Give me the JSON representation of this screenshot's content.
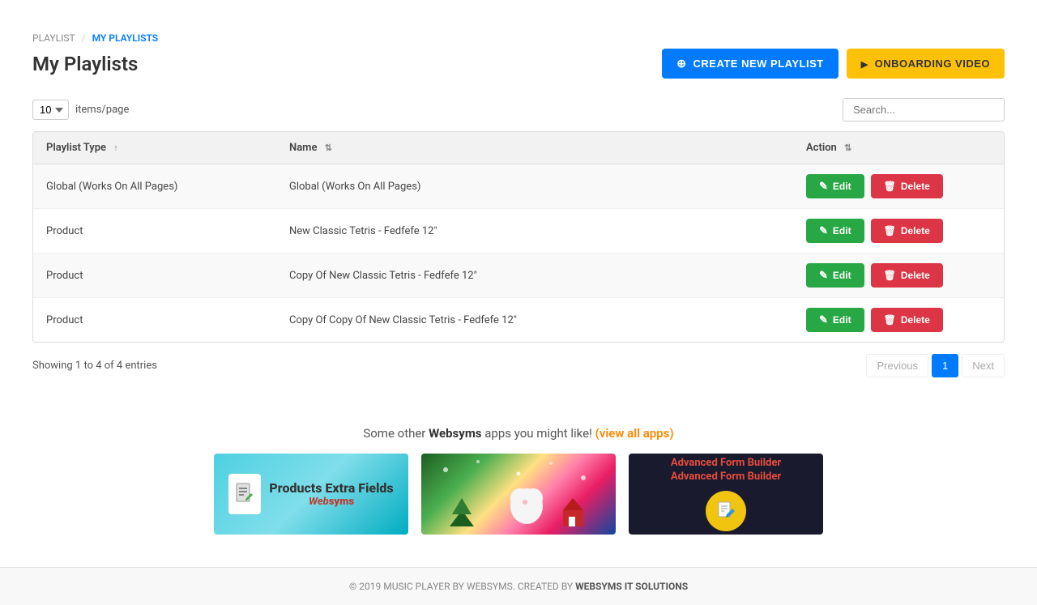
{
  "breadcrumb": {
    "root": "PLAYLIST",
    "separator": "/",
    "current": "MY PLAYLISTS"
  },
  "page_title": "My Playlists",
  "buttons": {
    "create": "CREATE NEW PLAYLIST",
    "onboarding": "ONBOARDING VIDEO"
  },
  "controls": {
    "items_per_page": "10",
    "items_label": "items/page",
    "search_placeholder": "Search..."
  },
  "table": {
    "columns": [
      {
        "id": "type",
        "label": "Playlist Type",
        "sortable": true,
        "sort_dir": "asc"
      },
      {
        "id": "name",
        "label": "Name",
        "sortable": true
      },
      {
        "id": "action",
        "label": "Action",
        "sortable": true
      }
    ],
    "rows": [
      {
        "type": "Global (Works On All Pages)",
        "name": "Global (Works On All Pages)"
      },
      {
        "type": "Product",
        "name": "New Classic Tetris - Fedfefe 12\""
      },
      {
        "type": "Product",
        "name": "Copy Of New Classic Tetris - Fedfefe 12\""
      },
      {
        "type": "Product",
        "name": "Copy Of Copy Of New Classic Tetris - Fedfefe 12\""
      }
    ],
    "edit_label": "Edit",
    "delete_label": "Delete"
  },
  "pagination": {
    "showing": "Showing 1 to 4 of 4 entries",
    "previous": "Previous",
    "page_1": "1",
    "next": "Next"
  },
  "apps": {
    "title_prefix": "Some other ",
    "brand": "Websyms",
    "title_suffix": " apps you might like!",
    "view_all": "(view all apps)",
    "app1_name": "Products Extra Fields",
    "app1_brand": "Websyms",
    "app2_alt": "Seasonal app",
    "app3_title1": "Advanced Form Builder",
    "app3_title2": "Advanced Form Builder"
  },
  "footer": {
    "text": "© 2019 MUSIC PLAYER BY WEBSYMS. CREATED BY ",
    "brand": "WEBSYMS IT SOLUTIONS"
  }
}
